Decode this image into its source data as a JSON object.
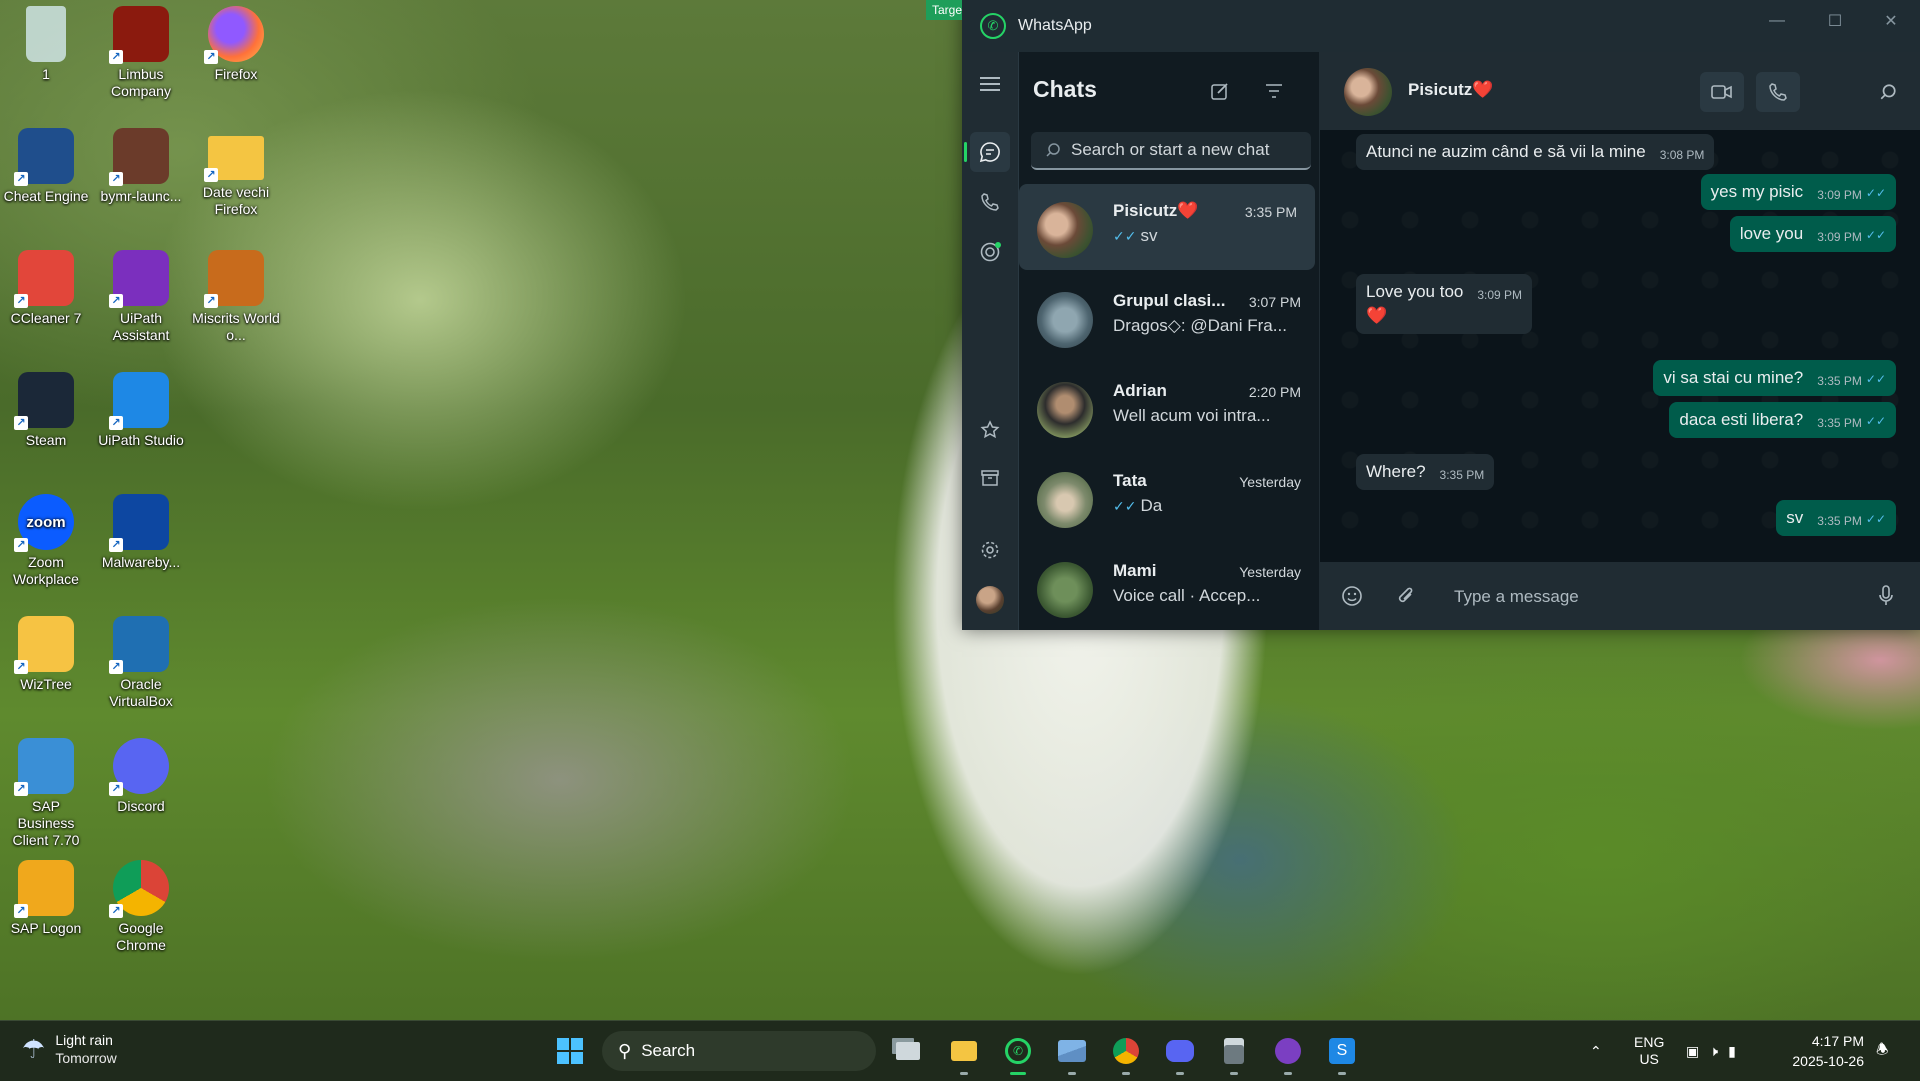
{
  "desktop": {
    "icons": [
      {
        "label": "1",
        "icon": "recycle-bin-icon",
        "color": "#cfe8f5"
      },
      {
        "label": "Limbus Company",
        "icon": "limbus-company-icon",
        "color": "#8b1a0e"
      },
      {
        "label": "Firefox",
        "icon": "firefox-icon",
        "color": "#ff7139"
      },
      {
        "label": "Cheat Engine",
        "icon": "cheat-engine-icon",
        "color": "#1f4e8c"
      },
      {
        "label": "bymr-launc...",
        "icon": "bymr-launcher-icon",
        "color": "#6b3b2a"
      },
      {
        "label": "Date vechi Firefox",
        "icon": "folder-icon",
        "color": "#f4c542"
      },
      {
        "label": "CCleaner 7",
        "icon": "ccleaner-icon",
        "color": "#e2463a"
      },
      {
        "label": "UiPath Assistant",
        "icon": "uipath-assistant-icon",
        "color": "#7b2fbe"
      },
      {
        "label": "Miscrits World o...",
        "icon": "miscrits-icon",
        "color": "#c86b1c"
      },
      {
        "label": "Steam",
        "icon": "steam-icon",
        "color": "#1b2838"
      },
      {
        "label": "UiPath Studio",
        "icon": "uipath-studio-icon",
        "color": "#1e88e5"
      },
      {
        "label": "Zoom Workplace",
        "icon": "zoom-icon",
        "color": "#0b5cff"
      },
      {
        "label": "Malwareby...",
        "icon": "malwarebytes-icon",
        "color": "#0d47a1"
      },
      {
        "label": "WizTree",
        "icon": "wiztree-icon",
        "color": "#f6c343"
      },
      {
        "label": "Oracle VirtualBox",
        "icon": "virtualbox-icon",
        "color": "#1f6fb2"
      },
      {
        "label": "SAP Business Client 7.70",
        "icon": "sap-business-client-icon",
        "color": "#3a8fd6"
      },
      {
        "label": "Discord",
        "icon": "discord-icon",
        "color": "#5865f2"
      },
      {
        "label": "SAP Logon",
        "icon": "sap-logon-icon",
        "color": "#f0a81c"
      },
      {
        "label": "Google Chrome",
        "icon": "chrome-icon",
        "color": "#db4437"
      }
    ],
    "zoom_glyph": "zoom"
  },
  "whatsapp": {
    "target_badge": "Target",
    "title": "WhatsApp",
    "list_title": "Chats",
    "search_placeholder": "Search or start a new chat",
    "chats": [
      {
        "name": "Pisicutz❤️",
        "time": "3:35 PM",
        "preview": "sv",
        "ticks": true
      },
      {
        "name": "Grupul clasi...",
        "time": "3:07 PM",
        "preview": "Dragos◇: @Dani Fra...",
        "ticks": false
      },
      {
        "name": "Adrian",
        "time": "2:20 PM",
        "preview": "Well acum voi intra...",
        "ticks": false
      },
      {
        "name": "Tata",
        "time": "Yesterday",
        "preview": "Da",
        "ticks": true
      },
      {
        "name": "Mami",
        "time": "Yesterday",
        "preview": "Voice call · Accep...",
        "ticks": false
      }
    ],
    "conversation": {
      "contact": "Pisicutz❤️",
      "messages": [
        {
          "dir": "in",
          "text": "Atunci ne auzim când e să vii la mine",
          "time": "3:08 PM"
        },
        {
          "dir": "out",
          "text": "yes my pisic",
          "time": "3:09 PM"
        },
        {
          "dir": "out",
          "text": "love you",
          "time": "3:09 PM"
        },
        {
          "dir": "in",
          "text": "Love you too",
          "time": "3:09 PM"
        },
        {
          "dir": "out",
          "text": "vi sa stai cu mine?",
          "time": "3:35 PM"
        },
        {
          "dir": "out",
          "text": "daca esti libera?",
          "time": "3:35 PM"
        },
        {
          "dir": "in",
          "text": "Where?",
          "time": "3:35 PM"
        },
        {
          "dir": "out",
          "text": "sv",
          "time": "3:35 PM"
        }
      ],
      "heart_emoji": "❤️",
      "composer_placeholder": "Type a message"
    },
    "colors": {
      "accent": "#25d366",
      "outgoing": "#005c4b",
      "incoming": "#202c33",
      "read_tick": "#53bdeb"
    }
  },
  "taskbar": {
    "weather_main": "Light rain",
    "weather_sub": "Tomorrow",
    "search_label": "Search",
    "apps": [
      "start-icon",
      "task-view-icon",
      "file-explorer-icon",
      "whatsapp-icon",
      "photos-icon",
      "chrome-icon",
      "discord-icon",
      "calculator-icon",
      "github-icon",
      "uipath-studio-icon"
    ],
    "lang_top": "ENG",
    "lang_bottom": "US",
    "time": "4:17 PM",
    "date": "2025-10-26"
  }
}
